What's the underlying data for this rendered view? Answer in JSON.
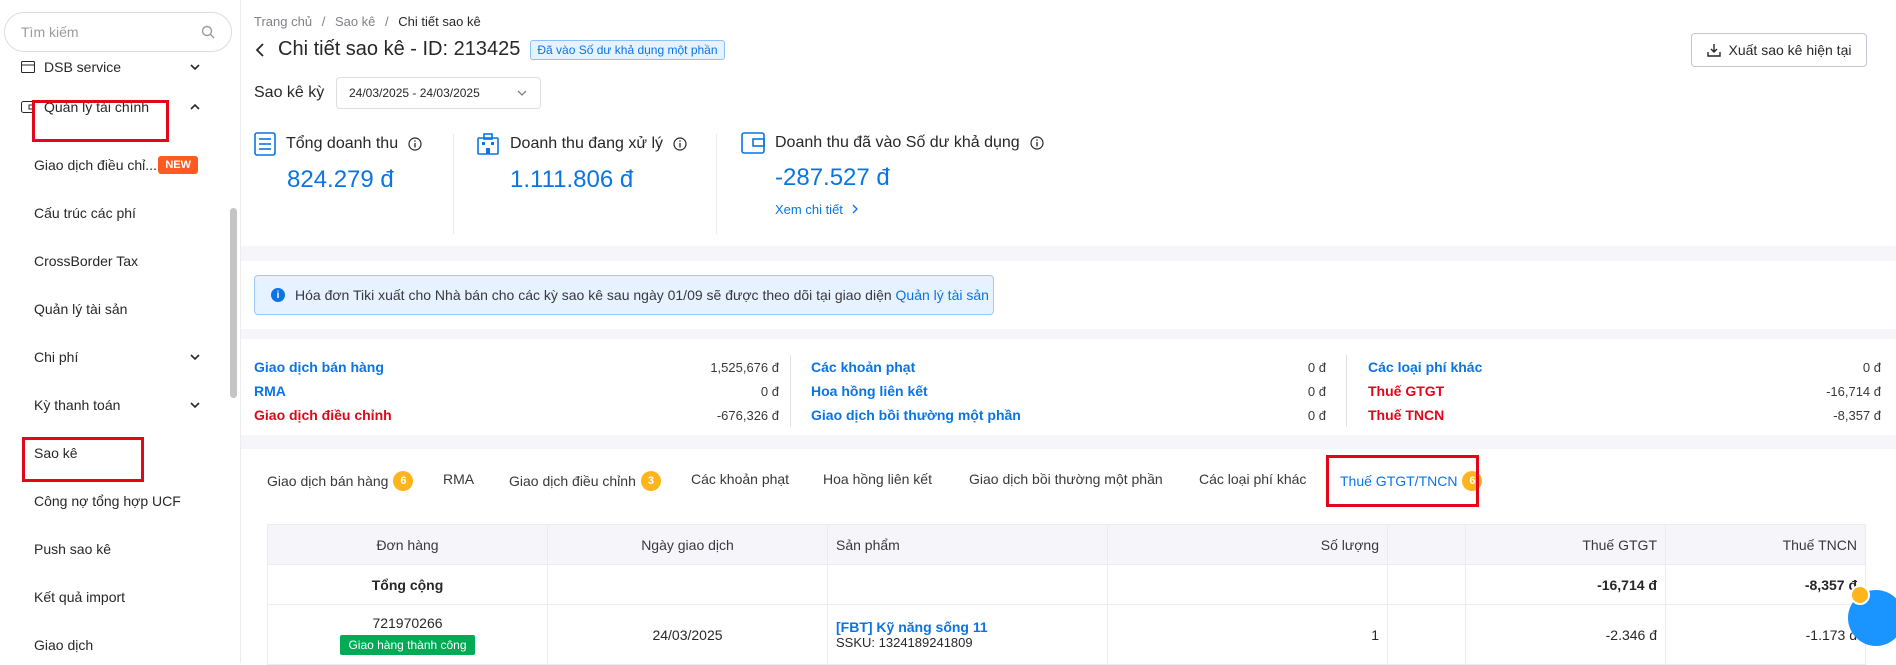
{
  "sidebar": {
    "search_placeholder": "Tìm kiếm",
    "items": [
      {
        "label": "DSB service",
        "icon": "dsb-icon"
      },
      {
        "label": "Quản lý tài chính",
        "icon": "wallet-icon"
      },
      {
        "label": "Giao dịch điều chỉ...",
        "badge": "NEW"
      },
      {
        "label": "Cấu trúc các phí"
      },
      {
        "label": "CrossBorder Tax"
      },
      {
        "label": "Quản lý tài sản"
      },
      {
        "label": "Chi phí"
      },
      {
        "label": "Kỳ thanh toán"
      },
      {
        "label": "Sao kê"
      },
      {
        "label": "Công nợ tổng hợp UCF"
      },
      {
        "label": "Push sao kê"
      },
      {
        "label": "Kết quả import"
      },
      {
        "label": "Giao dịch"
      }
    ]
  },
  "breadcrumb": {
    "home": "Trang chủ",
    "sep": "/",
    "parent": "Sao kê",
    "current": "Chi tiết sao kê"
  },
  "header": {
    "title": "Chi tiết sao kê - ID: 213425",
    "status": "Đã vào Số dư khả dụng một phần",
    "export_label": "Xuất sao kê hiện tại"
  },
  "period": {
    "label": "Sao kê kỳ",
    "value": "24/03/2025 - 24/03/2025"
  },
  "stats": [
    {
      "label": "Tổng doanh thu",
      "value": "824.279 đ"
    },
    {
      "label": "Doanh thu đang xử lý",
      "value": "1.111.806 đ"
    },
    {
      "label": "Doanh thu đã vào Số dư khả dụng",
      "value": "-287.527 đ",
      "link": "Xem chi tiết"
    }
  ],
  "info": {
    "text": "Hóa đơn Tiki xuất cho Nhà bán cho các kỳ sao kê sau ngày 01/09 sẽ được theo dõi tại giao diện",
    "link": "Quản lý tài sản"
  },
  "summary": {
    "col1": [
      {
        "k": "Giao dịch bán hàng",
        "v": "1,525,676 đ",
        "color": "#0b74e5"
      },
      {
        "k": "RMA",
        "v": "0 đ",
        "color": "#0b74e5"
      },
      {
        "k": "Giao dịch điều chỉnh",
        "v": "-676,326 đ",
        "color": "#e3061b"
      }
    ],
    "col2": [
      {
        "k": "Các khoản phạt",
        "v": "0 đ",
        "color": "#0b74e5"
      },
      {
        "k": "Hoa hồng liên kết",
        "v": "0 đ",
        "color": "#0b74e5"
      },
      {
        "k": "Giao dịch bồi thường một phần",
        "v": "0 đ",
        "color": "#0b74e5"
      }
    ],
    "col3": [
      {
        "k": "Các loại phí khác",
        "v": "0 đ",
        "color": "#0b74e5"
      },
      {
        "k": "Thuế GTGT",
        "v": "-16,714 đ",
        "color": "#e3061b"
      },
      {
        "k": "Thuế TNCN",
        "v": "-8,357 đ",
        "color": "#e3061b"
      }
    ]
  },
  "tabs": [
    {
      "label": "Giao dịch bán hàng",
      "count": "6"
    },
    {
      "label": "RMA"
    },
    {
      "label": "Giao dịch điều chỉnh",
      "count": "3"
    },
    {
      "label": "Các khoản phạt"
    },
    {
      "label": "Hoa hồng liên kết"
    },
    {
      "label": "Giao dịch bồi thường một phần"
    },
    {
      "label": "Các loại phí khác"
    },
    {
      "label": "Thuế GTGT/TNCN",
      "count": "6",
      "active": true
    }
  ],
  "table": {
    "headers": [
      "Đơn hàng",
      "Ngày giao dịch",
      "Sản phẩm",
      "Số lượng",
      "",
      "Thuế GTGT",
      "Thuế TNCN"
    ],
    "total": {
      "label": "Tổng cộng",
      "vat": "-16,714 đ",
      "pit": "-8,357 đ"
    },
    "rows": [
      {
        "order": "721970266",
        "status": "Giao hàng thành công",
        "date": "24/03/2025",
        "product": "[FBT] Kỹ năng sống 11",
        "sku": "SSKU: 1324189241809",
        "qty": "1",
        "vat": "-2.346 đ",
        "pit": "-1.173 đ"
      }
    ]
  },
  "colors": {
    "accent": "#0b74e5",
    "danger": "#e3061b",
    "badge": "#fdb51b",
    "new": "#ff5a1f",
    "success": "#00ab56"
  }
}
